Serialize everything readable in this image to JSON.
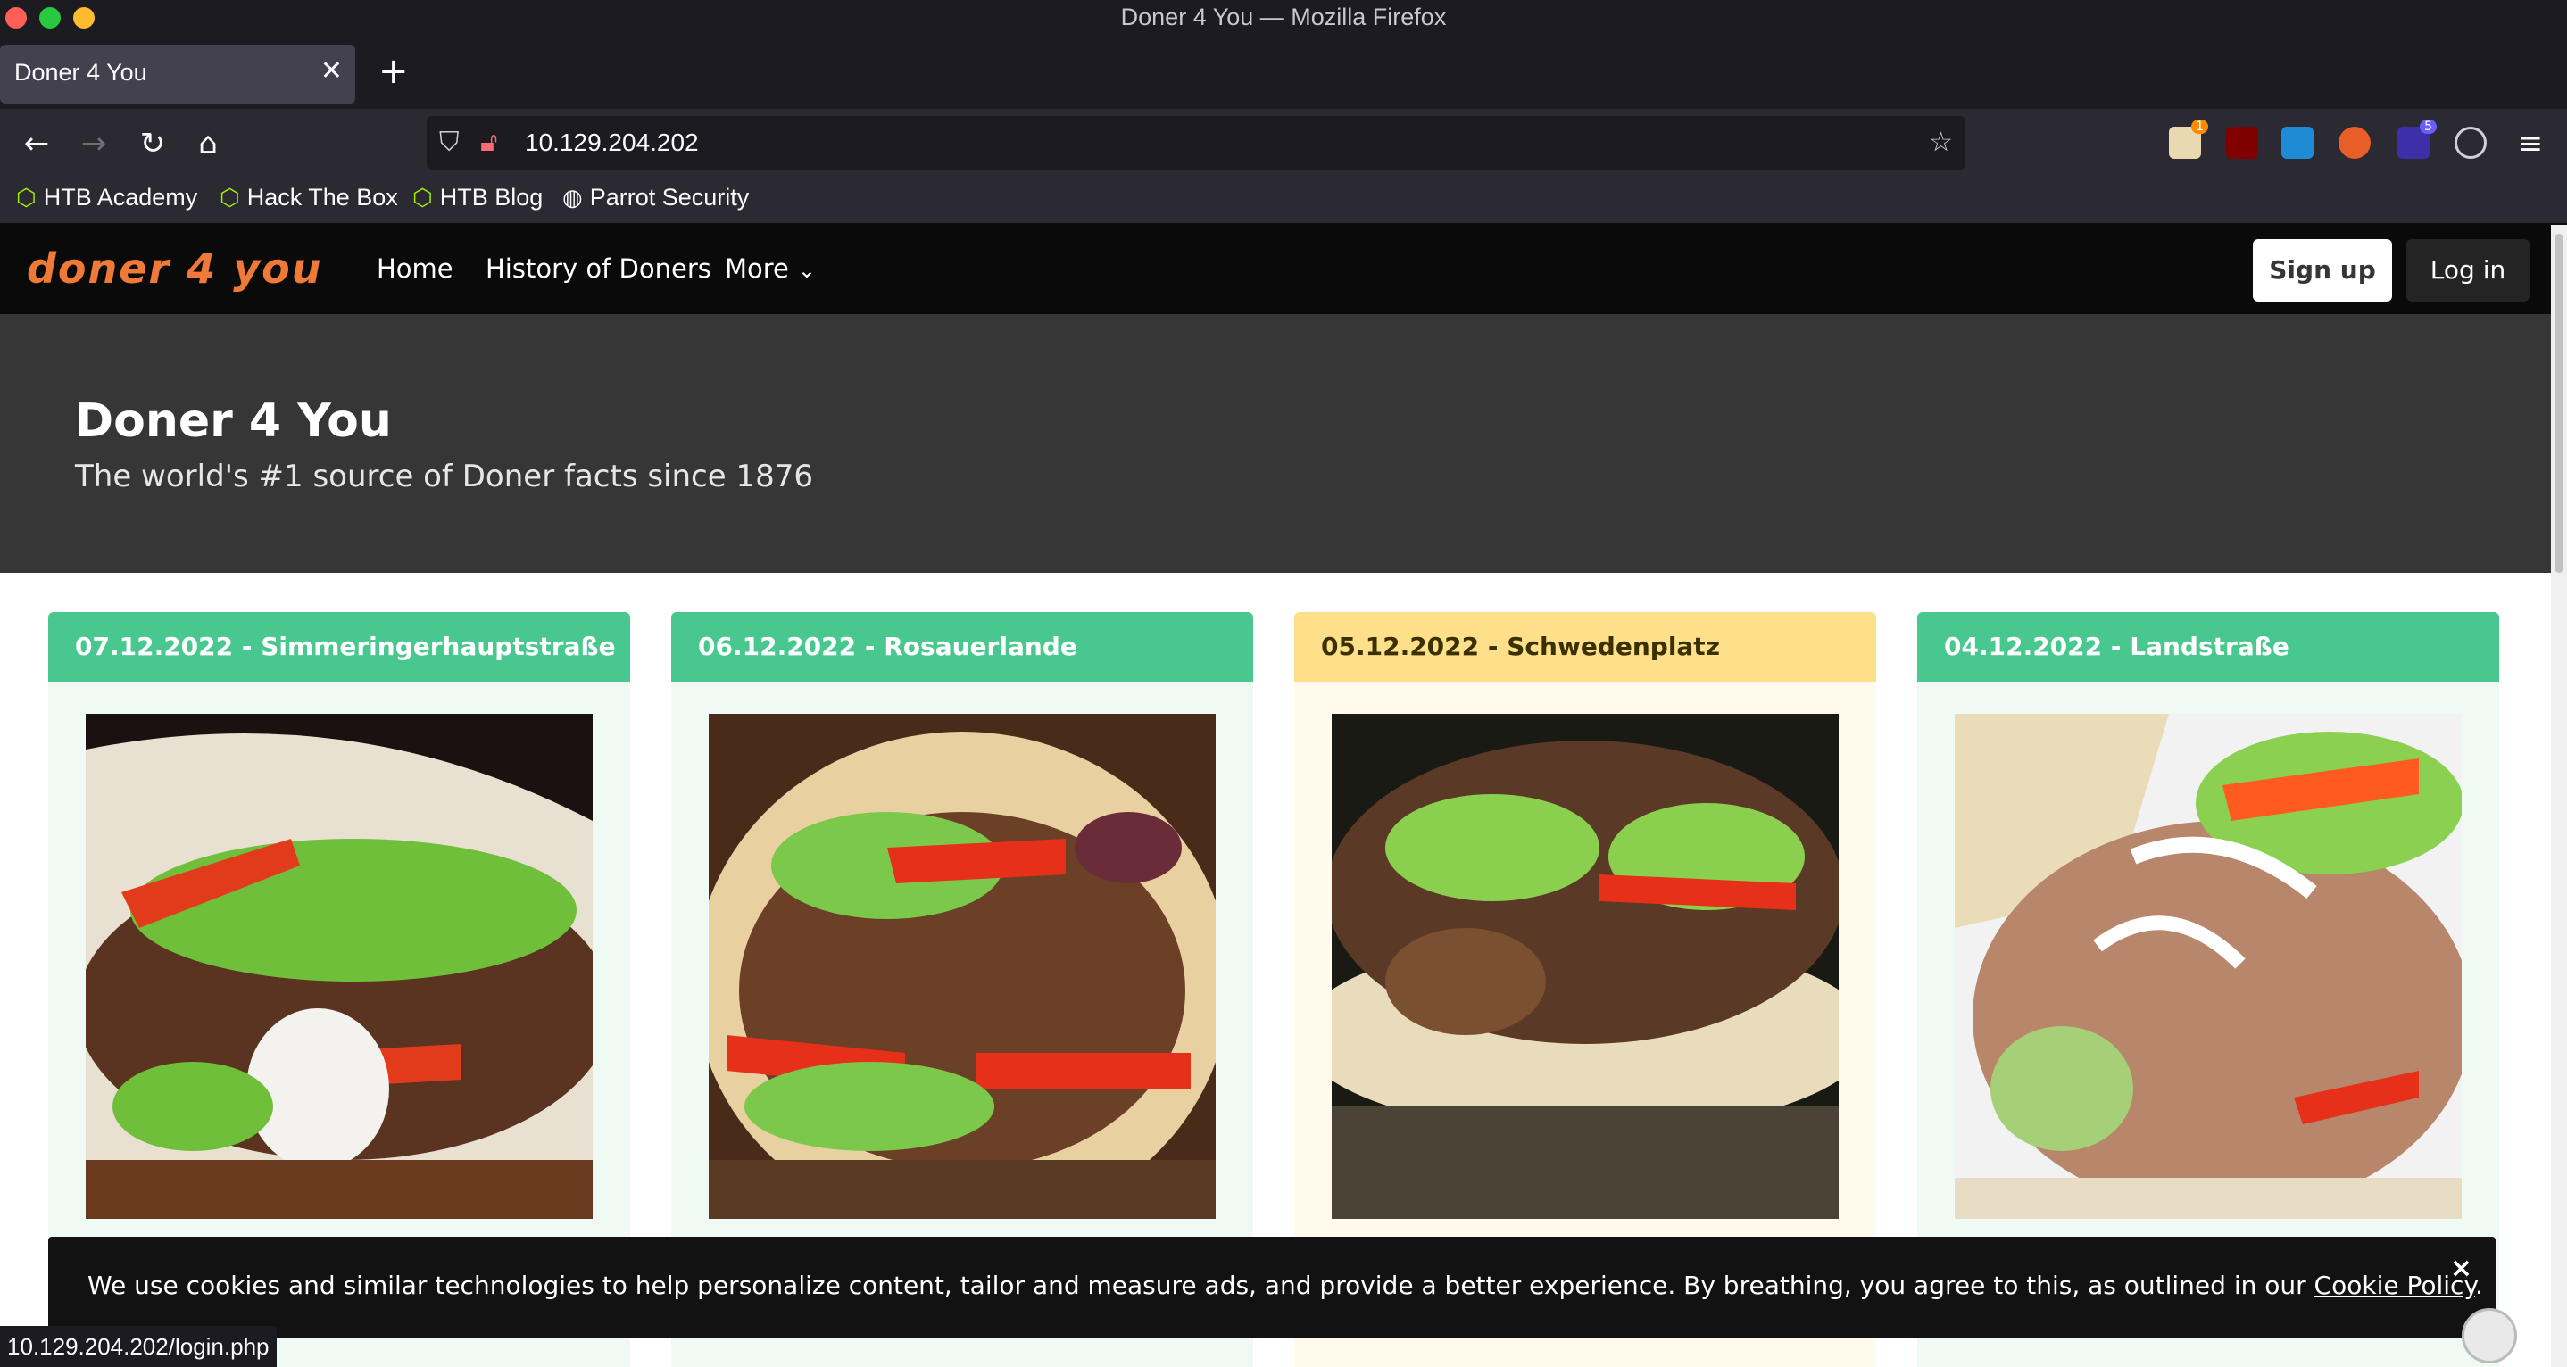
{
  "window": {
    "title": "Doner 4 You — Mozilla Firefox"
  },
  "tab": {
    "title": "Doner 4 You"
  },
  "urlbar": {
    "url": "10.129.204.202"
  },
  "extensions": [
    {
      "name": "extension-1",
      "badge": "1"
    },
    {
      "name": "ublock-origin-icon"
    },
    {
      "name": "extension-s-icon"
    },
    {
      "name": "extension-fox-icon"
    },
    {
      "name": "extension-5-icon",
      "badge": "5"
    },
    {
      "name": "extension-palette-icon"
    }
  ],
  "bookmarks": [
    {
      "label": "HTB Academy",
      "icon": "htb-icon"
    },
    {
      "label": "Hack The Box",
      "icon": "htb-icon"
    },
    {
      "label": "HTB Blog",
      "icon": "htb-icon"
    },
    {
      "label": "Parrot Security",
      "icon": "globe-icon"
    }
  ],
  "site": {
    "logo": "doner 4 you",
    "nav": {
      "home": "Home",
      "history": "History of Doners",
      "more": "More"
    },
    "buttons": {
      "signup": "Sign up",
      "login": "Log in"
    },
    "hero": {
      "title": "Doner 4 You",
      "subtitle": "The world's #1 source of Doner facts since 1876"
    },
    "cards": [
      {
        "header": "07.12.2022 - Simmeringerhauptstraße",
        "style": "green"
      },
      {
        "header": "06.12.2022 - Rosauerlande",
        "style": "green"
      },
      {
        "header": "05.12.2022 - Schwedenplatz",
        "style": "yellow"
      },
      {
        "header": "04.12.2022 - Landstraße",
        "style": "green"
      }
    ],
    "cookie": {
      "text": "We use cookies and similar technologies to help personalize content, tailor and measure ads, and provide a better experience. By breathing, you agree to this, as outlined in our ",
      "link": "Cookie Policy",
      "after": ".",
      "close": "×"
    }
  },
  "statusbar": {
    "text": "10.129.204.202/login.php"
  },
  "colors": {
    "green": "#48c78e",
    "yellow": "#ffe08a",
    "logo": "#ef7a37",
    "arrow": "#e3000f"
  }
}
